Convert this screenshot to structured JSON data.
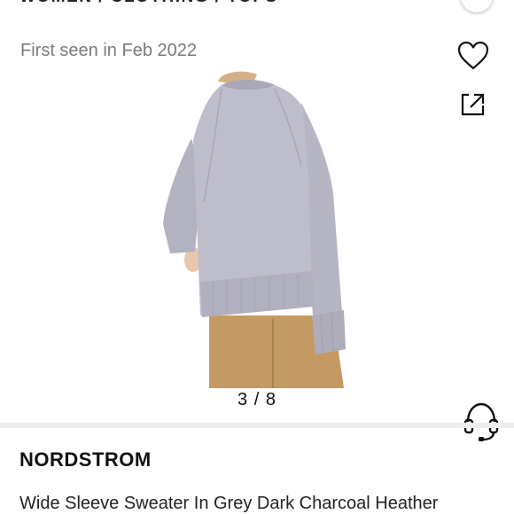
{
  "breadcrumb": "WOMEN / CLOTHING / TOPS",
  "first_seen": "First seen in Feb 2022",
  "actions": {
    "like_icon": "heart-icon",
    "share_icon": "share-icon",
    "support_icon": "headset-icon"
  },
  "gallery": {
    "counter": "3 / 8",
    "current": 3,
    "total": 8
  },
  "product": {
    "brand": "NORDSTROM",
    "title": "Wide Sleeve Sweater In Grey Dark Charcoal Heather"
  },
  "colors": {
    "sweater": "#b9b8c6",
    "pants": "#c39a63",
    "divider": "#eeeeee"
  }
}
